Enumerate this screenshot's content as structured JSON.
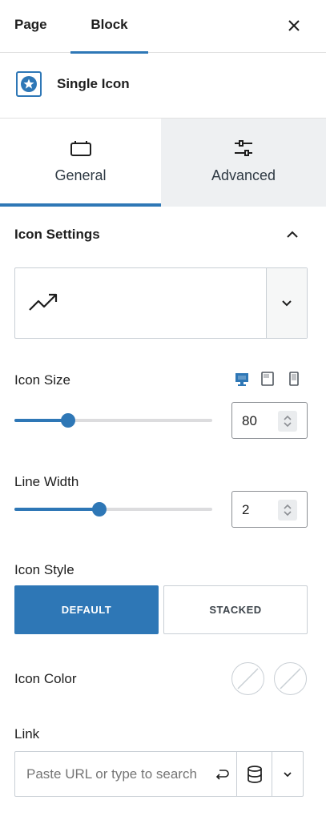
{
  "top_tabs": {
    "page": "Page",
    "block": "Block"
  },
  "block": {
    "title": "Single Icon"
  },
  "panel_tabs": {
    "general": "General",
    "advanced": "Advanced"
  },
  "section": {
    "title": "Icon Settings",
    "expanded": true
  },
  "icon_picker": {
    "selected_icon": "trending-up-icon"
  },
  "icon_size": {
    "label": "Icon Size",
    "value": "80",
    "slider_fraction": 0.27,
    "devices": [
      "desktop",
      "tablet",
      "mobile"
    ],
    "active_device": "desktop"
  },
  "line_width": {
    "label": "Line Width",
    "value": "2",
    "slider_fraction": 0.43
  },
  "icon_style": {
    "label": "Icon Style",
    "options": [
      "DEFAULT",
      "STACKED"
    ],
    "selected": "DEFAULT"
  },
  "icon_color": {
    "label": "Icon Color"
  },
  "link": {
    "label": "Link",
    "placeholder": "Paste URL or type to search"
  },
  "colors": {
    "accent": "#2e77b6",
    "border": "#c9cfd5",
    "tab_inactive_bg": "#eef0f2",
    "slider_track": "#dcdcde"
  }
}
